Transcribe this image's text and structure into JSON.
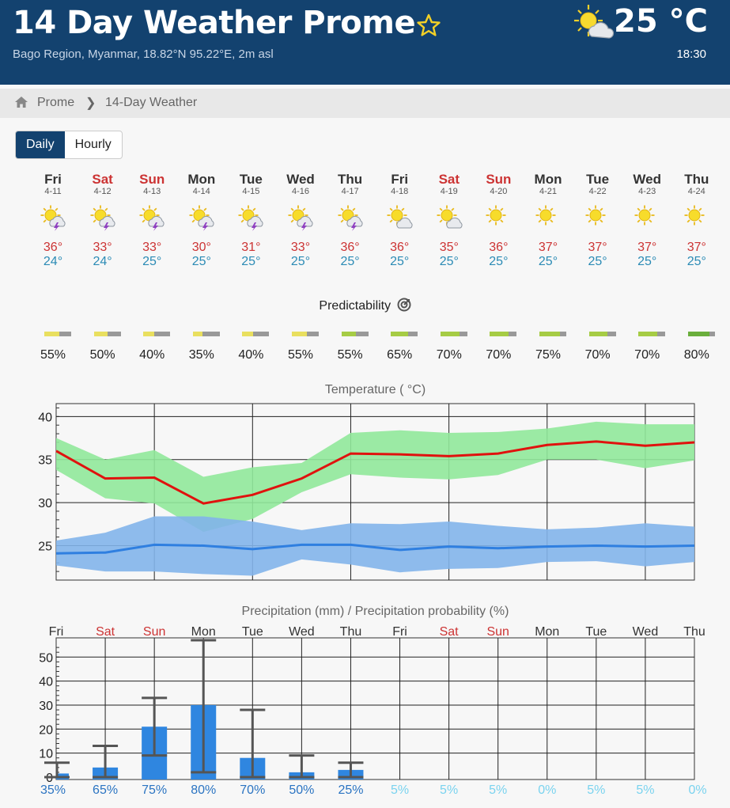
{
  "header": {
    "title": "14 Day Weather Prome",
    "subtitle": "Bago Region, Myanmar, 18.82°N 95.22°E, 2m asl",
    "temperature": "25 °C",
    "time": "18:30",
    "weather_icon": "sun-cloud-icon",
    "favorite_icon": "star-outline-icon"
  },
  "breadcrumb": {
    "home_icon": "home-icon",
    "items": [
      "Prome",
      "14-Day Weather"
    ],
    "separator": "❯"
  },
  "view_toggle": {
    "daily": "Daily",
    "hourly": "Hourly",
    "selected": "Daily"
  },
  "days": [
    {
      "name": "Fri",
      "date": "4-11",
      "icon": "sun-thunderstorm-icon",
      "max": "36°",
      "min": "24°",
      "weekend": false
    },
    {
      "name": "Sat",
      "date": "4-12",
      "icon": "sun-thunderstorm-icon",
      "max": "33°",
      "min": "24°",
      "weekend": true
    },
    {
      "name": "Sun",
      "date": "4-13",
      "icon": "sun-thunderstorm-icon",
      "max": "33°",
      "min": "25°",
      "weekend": true
    },
    {
      "name": "Mon",
      "date": "4-14",
      "icon": "sun-thunderstorm-icon",
      "max": "30°",
      "min": "25°",
      "weekend": false
    },
    {
      "name": "Tue",
      "date": "4-15",
      "icon": "sun-thunderstorm-icon",
      "max": "31°",
      "min": "25°",
      "weekend": false
    },
    {
      "name": "Wed",
      "date": "4-16",
      "icon": "sun-thunderstorm-icon",
      "max": "33°",
      "min": "25°",
      "weekend": false
    },
    {
      "name": "Thu",
      "date": "4-17",
      "icon": "sun-thunderstorm-icon",
      "max": "36°",
      "min": "25°",
      "weekend": false
    },
    {
      "name": "Fri",
      "date": "4-18",
      "icon": "sun-cloud-icon",
      "max": "36°",
      "min": "25°",
      "weekend": false
    },
    {
      "name": "Sat",
      "date": "4-19",
      "icon": "sun-cloud-icon",
      "max": "35°",
      "min": "25°",
      "weekend": true
    },
    {
      "name": "Sun",
      "date": "4-20",
      "icon": "sun-icon",
      "max": "36°",
      "min": "25°",
      "weekend": true
    },
    {
      "name": "Mon",
      "date": "4-21",
      "icon": "sun-icon",
      "max": "37°",
      "min": "25°",
      "weekend": false
    },
    {
      "name": "Tue",
      "date": "4-22",
      "icon": "sun-icon",
      "max": "37°",
      "min": "25°",
      "weekend": false
    },
    {
      "name": "Wed",
      "date": "4-23",
      "icon": "sun-icon",
      "max": "37°",
      "min": "25°",
      "weekend": false
    },
    {
      "name": "Thu",
      "date": "4-24",
      "icon": "sun-icon",
      "max": "37°",
      "min": "25°",
      "weekend": false
    }
  ],
  "predictability": {
    "title": "Predictability",
    "icon": "predictability-target-icon",
    "values": [
      "55%",
      "50%",
      "40%",
      "35%",
      "40%",
      "55%",
      "55%",
      "65%",
      "70%",
      "70%",
      "75%",
      "70%",
      "70%",
      "80%"
    ],
    "fractions": [
      0.55,
      0.5,
      0.4,
      0.35,
      0.4,
      0.55,
      0.55,
      0.65,
      0.7,
      0.7,
      0.75,
      0.7,
      0.7,
      0.8
    ],
    "colors": [
      "#e9df5f",
      "#e9df5f",
      "#e9df5f",
      "#e9df5f",
      "#e9df5f",
      "#e9df5f",
      "#a6cc45",
      "#a6cc45",
      "#a6cc45",
      "#a6cc45",
      "#a6cc45",
      "#a6cc45",
      "#a6cc45",
      "#6aae3c"
    ]
  },
  "chart_data": [
    {
      "type": "line",
      "title": "Temperature ( °C)",
      "yticks": [
        25,
        30,
        35,
        40
      ],
      "ylim": [
        21,
        41.5
      ],
      "grid": true,
      "series": [
        {
          "color": "#e0120e",
          "values": [
            36,
            32.8,
            32.9,
            29.9,
            30.9,
            32.8,
            35.7,
            35.6,
            35.4,
            35.7,
            36.7,
            37.1,
            36.6,
            37.0
          ]
        },
        {
          "color": "#90e89a",
          "lower": [
            33.8,
            30.5,
            29.9,
            26.6,
            28.1,
            31.2,
            33.3,
            32.9,
            32.7,
            33.2,
            35.0,
            35.0,
            34.0,
            34.9
          ],
          "upper": [
            37.5,
            35.0,
            36.1,
            33.0,
            34.1,
            34.6,
            38.1,
            38.4,
            38.1,
            38.2,
            38.6,
            39.4,
            39.1,
            39.1
          ]
        },
        {
          "color": "#2f7fe0",
          "values": [
            24.1,
            24.2,
            25.1,
            25.0,
            24.6,
            25.1,
            25.1,
            24.5,
            24.9,
            24.7,
            24.9,
            25.0,
            24.9,
            25.0
          ]
        },
        {
          "color": "#82b4ea",
          "lower": [
            22.7,
            22.0,
            22.0,
            21.7,
            21.5,
            23.4,
            22.8,
            21.9,
            22.3,
            22.4,
            23.1,
            23.2,
            22.6,
            23.1
          ],
          "upper": [
            25.6,
            26.5,
            28.4,
            28.4,
            27.8,
            26.8,
            27.6,
            27.5,
            27.8,
            27.3,
            26.9,
            27.1,
            27.6,
            27.2
          ]
        }
      ]
    },
    {
      "type": "bar",
      "title": "Precipitation (mm) / Precipitation probability (%)",
      "categories": [
        "Fri",
        "Sat",
        "Sun",
        "Mon",
        "Tue",
        "Wed",
        "Thu",
        "Fri",
        "Sat",
        "Sun",
        "Mon",
        "Tue",
        "Wed",
        "Thu"
      ],
      "weekend": [
        false,
        true,
        true,
        false,
        false,
        false,
        false,
        false,
        true,
        true,
        false,
        false,
        false,
        false
      ],
      "yticks": [
        0,
        10,
        20,
        30,
        40,
        50
      ],
      "ylim": [
        -1,
        58
      ],
      "grid": true,
      "values": [
        1.5,
        4,
        21,
        30,
        8,
        2,
        3,
        0,
        0,
        0,
        0,
        0,
        0,
        0
      ],
      "error_low": [
        0,
        0,
        9,
        2,
        0,
        0,
        0,
        0,
        0,
        0,
        0,
        0,
        0,
        0
      ],
      "error_high": [
        6,
        13,
        33,
        57,
        28,
        9,
        6,
        0,
        0,
        0,
        0,
        0,
        0,
        0
      ],
      "probability": [
        "35%",
        "65%",
        "75%",
        "80%",
        "70%",
        "50%",
        "25%",
        "5%",
        "5%",
        "5%",
        "0%",
        "5%",
        "5%",
        "0%"
      ],
      "bar_color": "#2f86e0",
      "error_color": "#555555"
    }
  ]
}
